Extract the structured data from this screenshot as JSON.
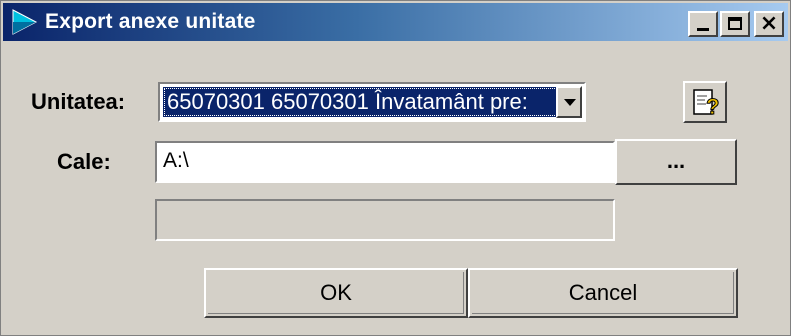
{
  "window": {
    "title": "Export anexe unitate",
    "minimize_label": "_",
    "close_label": "×"
  },
  "form": {
    "unit_label": "Unitatea:",
    "unit_value": "65070301  65070301 Învatamânt pre:",
    "path_label": "Cale:",
    "path_value": "A:\\",
    "browse_label": "...",
    "progress_value": ""
  },
  "buttons": {
    "ok": "OK",
    "cancel": "Cancel"
  },
  "colors": {
    "title_start": "#0a246a",
    "title_end": "#a6caf0",
    "selection": "#0a246a",
    "dialog_bg": "#d4d0c8"
  },
  "icons": {
    "app": "arrow-triangle-icon",
    "help": "help-document-icon",
    "dropdown": "chevron-down-icon"
  }
}
